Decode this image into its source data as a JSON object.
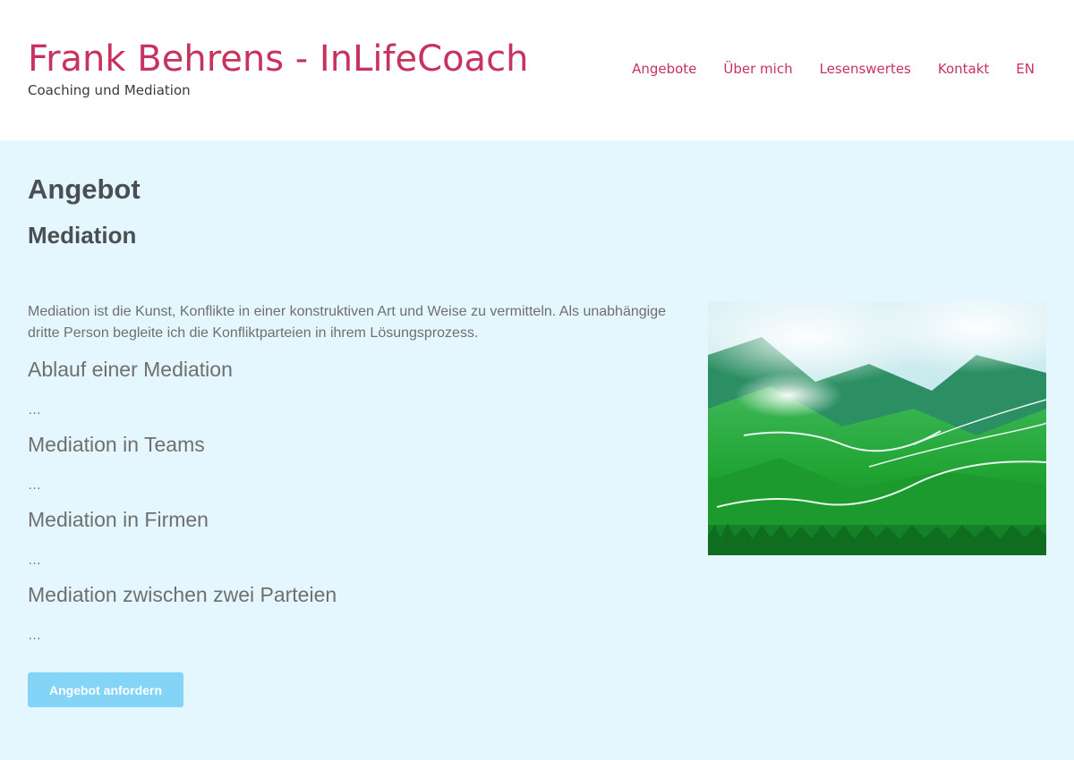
{
  "header": {
    "title": "Frank Behrens - InLifeCoach",
    "tagline": "Coaching und Mediation",
    "nav": [
      "Angebote",
      "Über mich",
      "Lesenswertes",
      "Kontakt",
      "EN"
    ]
  },
  "main": {
    "heading": "Angebot",
    "subheading": "Mediation",
    "intro": "Mediation ist die Kunst, Konflikte in einer konstruktiven Art und Weise zu vermitteln. Als unabhängige dritte Person begleite ich die Konfliktparteien in ihrem Lösungsprozess.",
    "sections": [
      {
        "title": "Ablauf einer Mediation",
        "text": "…"
      },
      {
        "title": "Mediation in Teams",
        "text": "…"
      },
      {
        "title": "Mediation in Firmen",
        "text": "…"
      },
      {
        "title": "Mediation zwischen zwei Parteien",
        "text": "…"
      }
    ],
    "button_label": "Angebot anfordern",
    "image_icon": "mountain-landscape-photo"
  },
  "colors": {
    "brand": "#c8325e",
    "background": "#e5f7fe",
    "button": "#83d4f7",
    "heading": "#4a4f55",
    "text": "#6f6f6f"
  }
}
